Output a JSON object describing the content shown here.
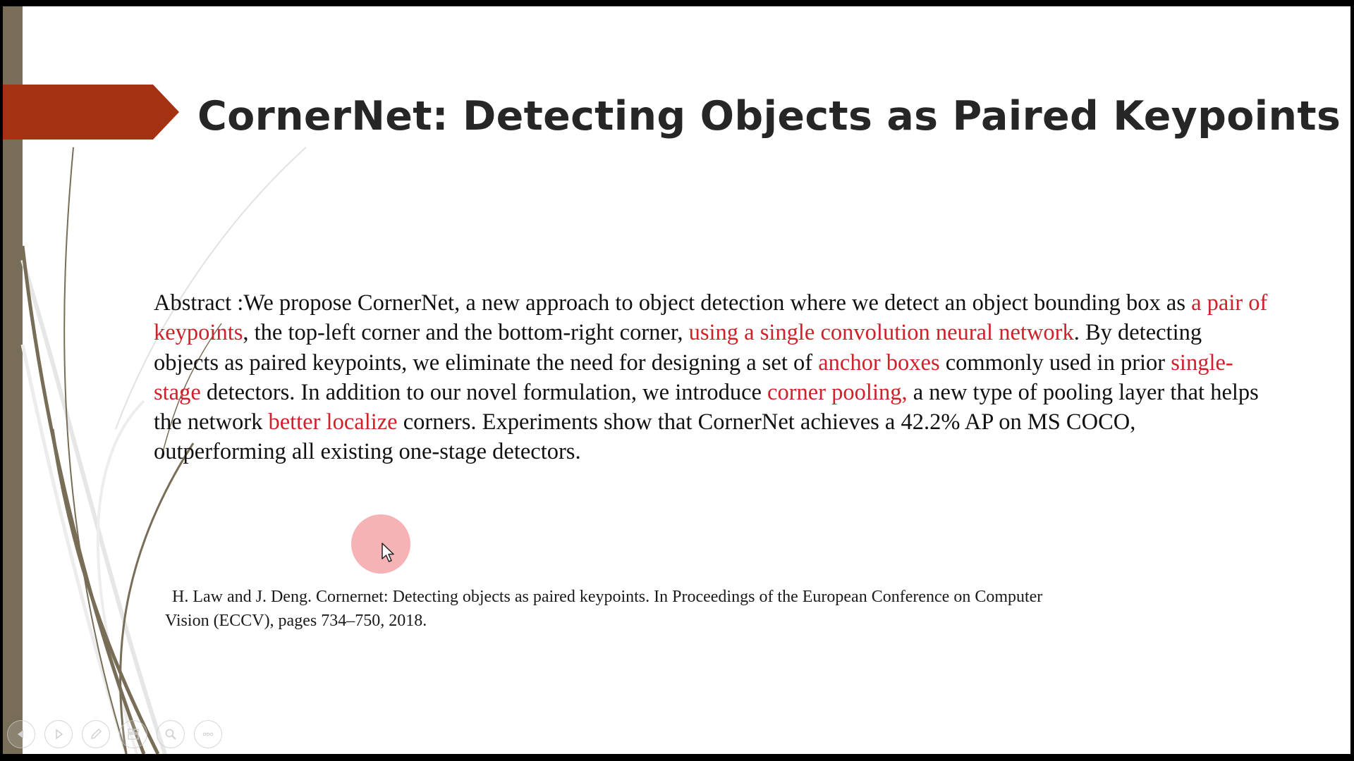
{
  "slide": {
    "title": "CornerNet: Detecting Objects as Paired Keypoints",
    "abstract_segments": [
      {
        "text": "Abstract :We propose CornerNet, a new approach to object detection where we detect an object bounding box as ",
        "highlight": false
      },
      {
        "text": "a pair of keypoints",
        "highlight": true
      },
      {
        "text": ", the top-left corner and the bottom-right corner, ",
        "highlight": false
      },
      {
        "text": "using a single convolution neural network",
        "highlight": true
      },
      {
        "text": ". By detecting objects as paired keypoints, we eliminate the need for designing a set of ",
        "highlight": false
      },
      {
        "text": "anchor boxes",
        "highlight": true
      },
      {
        "text": " commonly used in prior ",
        "highlight": false
      },
      {
        "text": "single-stage",
        "highlight": true
      },
      {
        "text": " detectors. In addition to our novel formulation, we introduce ",
        "highlight": false
      },
      {
        "text": "corner pooling,",
        "highlight": true
      },
      {
        "text": " a new type of pooling layer that helps the network ",
        "highlight": false
      },
      {
        "text": "better localize",
        "highlight": true
      },
      {
        "text": " corners. Experiments show that CornerNet achieves a 42.2% AP on MS COCO, outperforming all existing one-stage detectors.",
        "highlight": false
      }
    ],
    "citation": {
      "line1": "H. Law and J. Deng. Cornernet: Detecting objects as paired keypoints. In Proceedings of the European Conference on Computer",
      "line2": "Vision (ECCV), pages 734–750, 2018."
    }
  },
  "colors": {
    "accent_arrow": "#a53113",
    "sidebar": "#786d57",
    "highlight_text": "#d0202a",
    "title_text": "#262626",
    "cursor_highlight": "#f6b3b6"
  },
  "toolbar": {
    "buttons": [
      {
        "name": "previous-slide-button",
        "icon": "chevron-left-icon"
      },
      {
        "name": "next-slide-button",
        "icon": "play-icon"
      },
      {
        "name": "pen-tool-button",
        "icon": "pen-icon"
      },
      {
        "name": "see-all-slides-button",
        "icon": "slides-grid-icon"
      },
      {
        "name": "zoom-button",
        "icon": "magnifier-icon"
      },
      {
        "name": "more-options-button",
        "icon": "ellipsis-icon"
      }
    ]
  }
}
